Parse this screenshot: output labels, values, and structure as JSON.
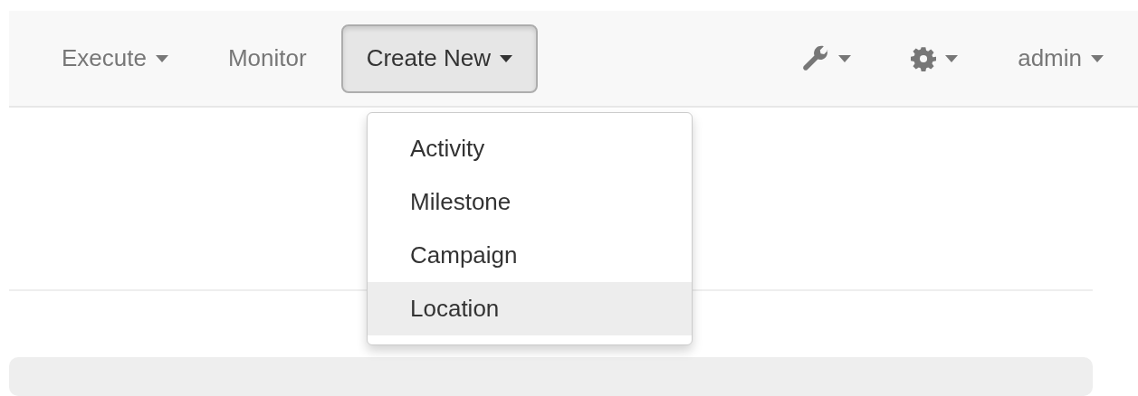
{
  "navbar": {
    "left": [
      {
        "label": "Execute",
        "caret": true,
        "active": false
      },
      {
        "label": "Monitor",
        "caret": false,
        "active": false
      },
      {
        "label": "Create New",
        "caret": true,
        "active": true
      }
    ],
    "right": [
      {
        "kind": "wrench"
      },
      {
        "kind": "gear"
      },
      {
        "kind": "text",
        "label": "admin"
      }
    ]
  },
  "dropdown": {
    "items": [
      {
        "label": "Activity",
        "highlighted": false
      },
      {
        "label": "Milestone",
        "highlighted": false
      },
      {
        "label": "Campaign",
        "highlighted": false
      },
      {
        "label": "Location",
        "highlighted": true
      }
    ]
  }
}
